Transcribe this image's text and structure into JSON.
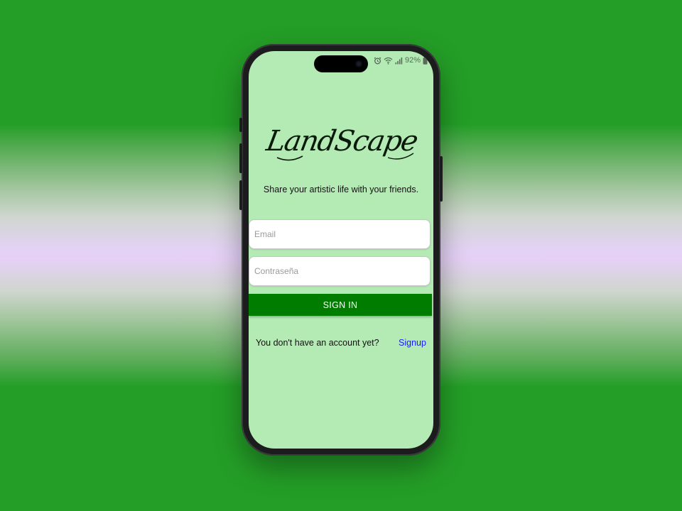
{
  "status_bar": {
    "battery": "92%",
    "icons": [
      "alarm-icon",
      "wifi-icon",
      "signal-icon",
      "battery-icon"
    ]
  },
  "app": {
    "logo_text": "LandScape",
    "tagline": "Share your artistic life with your friends."
  },
  "form": {
    "email_placeholder": "Email",
    "password_placeholder": "Contraseña",
    "sign_in_label": "SIGN IN"
  },
  "footer": {
    "no_account_text": "You don't have an account yet?",
    "signup_label": "Signup"
  },
  "colors": {
    "background": "#249e27",
    "screen": "#b4ebb4",
    "button": "#007d00",
    "link": "#1a1aff"
  }
}
